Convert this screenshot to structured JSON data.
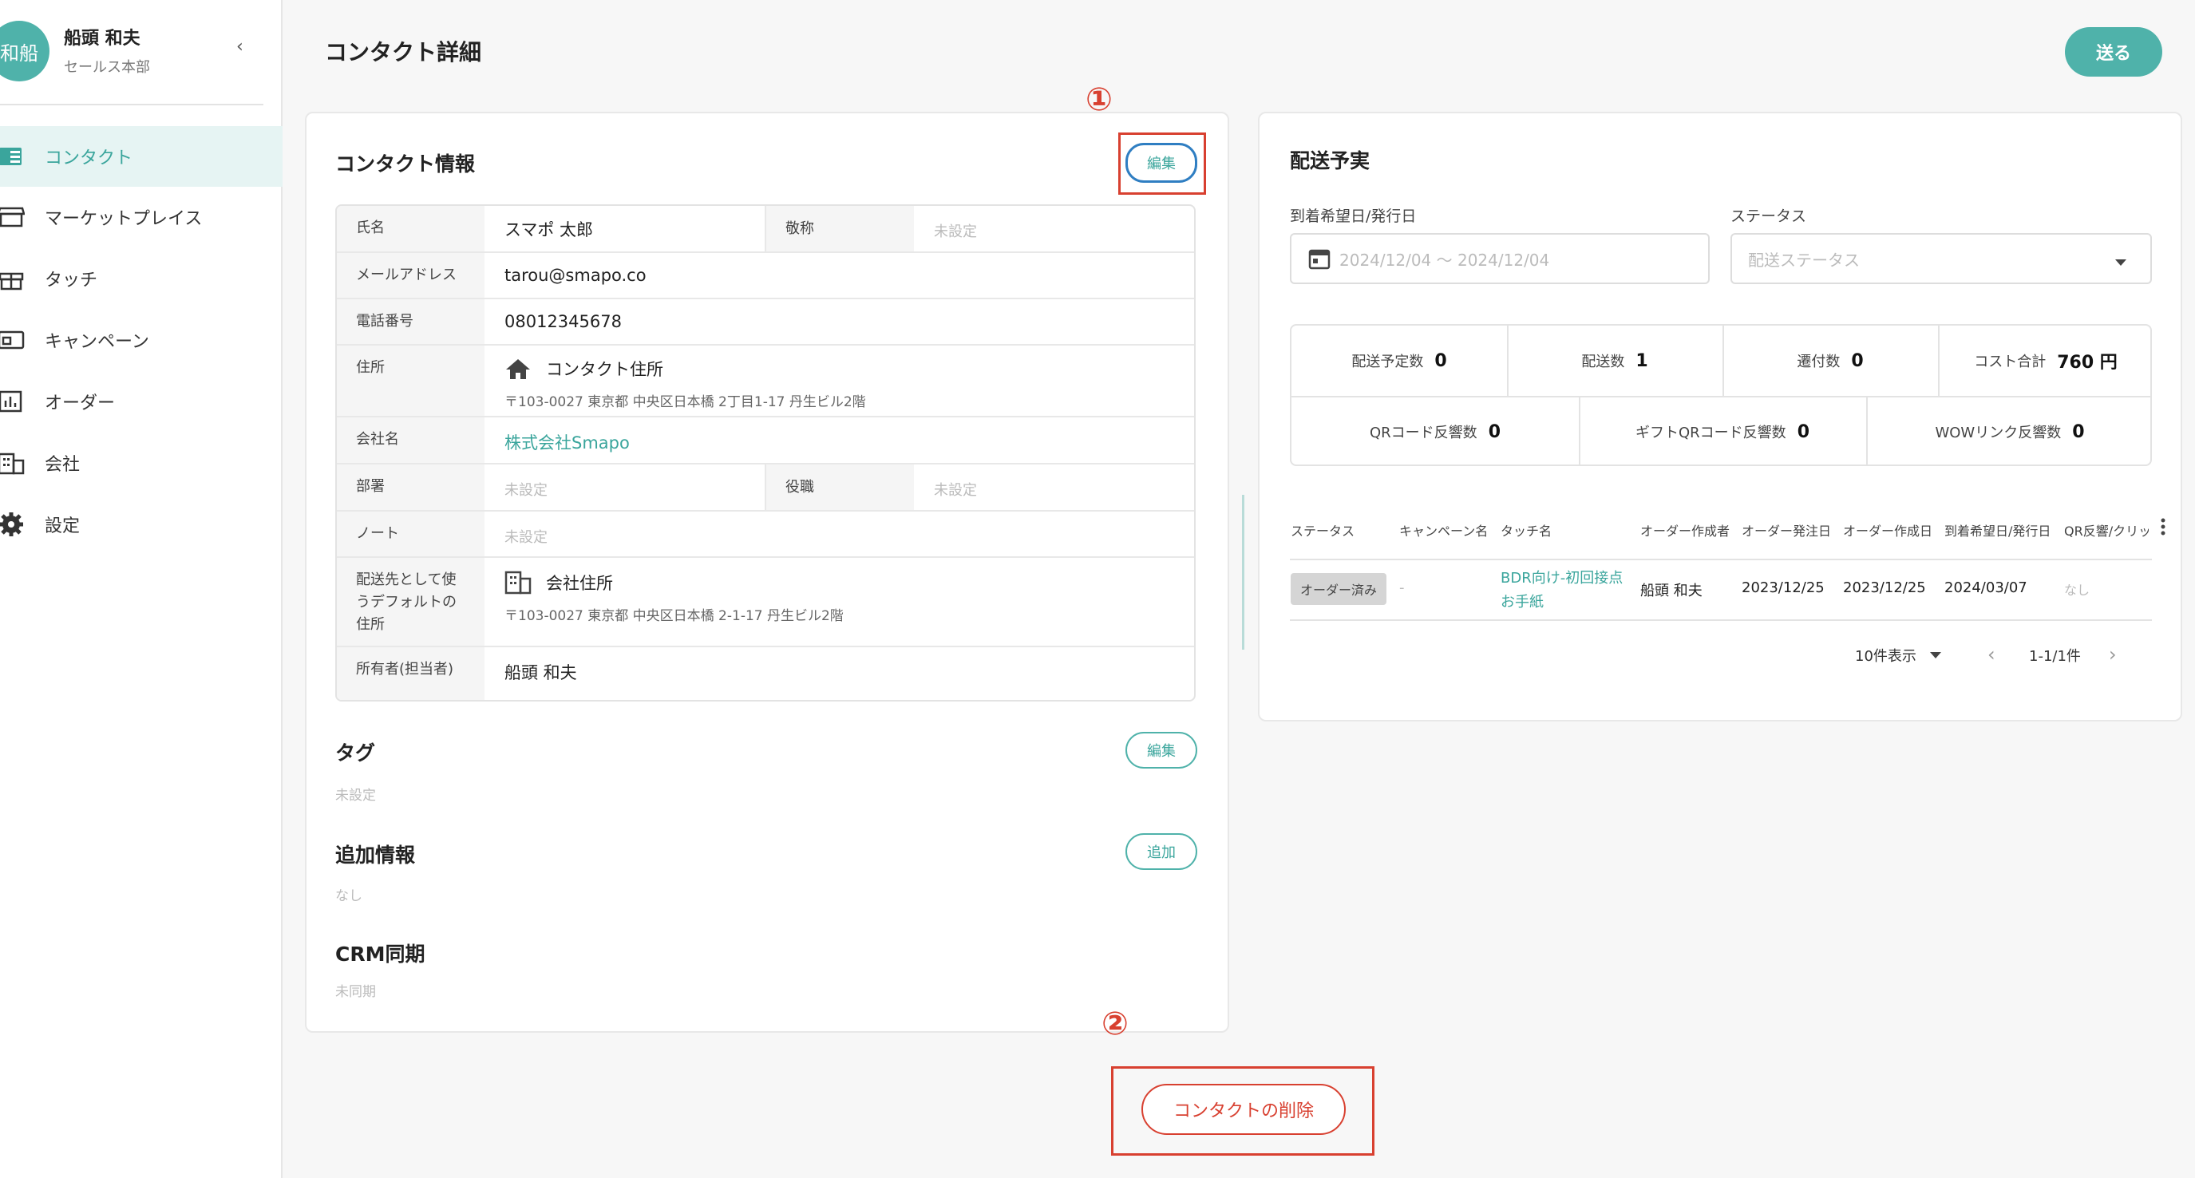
{
  "sidebar": {
    "avatar_text": "和船",
    "user_name": "船頭 和夫",
    "user_dept": "セールス本部",
    "collapse_icon": "‹",
    "items": [
      {
        "label": "コンタクト",
        "icon": "contact-book-icon"
      },
      {
        "label": "マーケットプレイス",
        "icon": "store-icon"
      },
      {
        "label": "タッチ",
        "icon": "gift-icon"
      },
      {
        "label": "キャンペーン",
        "icon": "campaign-icon"
      },
      {
        "label": "オーダー",
        "icon": "chart-icon"
      },
      {
        "label": "会社",
        "icon": "building-icon"
      },
      {
        "label": "設定",
        "icon": "gear-icon"
      }
    ]
  },
  "header": {
    "title": "コンタクト詳細",
    "send_label": "送る"
  },
  "contact": {
    "section_title": "コンタクト情報",
    "edit_label": "編集",
    "rows": {
      "name_label": "氏名",
      "name_value": "スマポ 太郎",
      "honorific_label": "敬称",
      "honorific_value": "未設定",
      "email_label": "メールアドレス",
      "email_value": "tarou@smapo.co",
      "phone_label": "電話番号",
      "phone_value": "08012345678",
      "address_label": "住所",
      "address_title": "コンタクト住所",
      "address_value": "〒103-0027 東京都 中央区日本橋 2丁目1-17 丹生ビル2階",
      "company_label": "会社名",
      "company_value": "株式会社Smapo",
      "department_label": "部署",
      "department_value": "未設定",
      "position_label": "役職",
      "position_value": "未設定",
      "note_label": "ノート",
      "note_value": "未設定",
      "default_addr_label": "配送先として使うデフォルトの住所",
      "default_addr_title": "会社住所",
      "default_addr_value": "〒103-0027 東京都 中央区日本橋 2-1-17 丹生ビル2階",
      "owner_label": "所有者(担当者)",
      "owner_value": "船頭 和夫"
    }
  },
  "tags": {
    "title": "タグ",
    "edit_label": "編集",
    "value": "未設定"
  },
  "extra": {
    "title": "追加情報",
    "add_label": "追加",
    "value": "なし"
  },
  "crm": {
    "title": "CRM同期",
    "value": "未同期"
  },
  "delete_label": "コンタクトの削除",
  "annotations": {
    "one": "①",
    "two": "②"
  },
  "delivery": {
    "title": "配送予実",
    "date_label": "到着希望日/発行日",
    "date_value": "2024/12/04 〜 2024/12/04",
    "status_label": "ステータス",
    "status_placeholder": "配送ステータス",
    "stats": [
      {
        "label": "配送予定数",
        "value": "0"
      },
      {
        "label": "配送数",
        "value": "1"
      },
      {
        "label": "遷付数",
        "value": "0"
      },
      {
        "label": "コスト合計",
        "value": "760 円"
      },
      {
        "label": "QRコード反響数",
        "value": "0"
      },
      {
        "label": "ギフトQRコード反響数",
        "value": "0"
      },
      {
        "label": "WOWリンク反響数",
        "value": "0"
      }
    ],
    "columns": [
      "ステータス",
      "キャンペーン名",
      "タッチ名",
      "オーダー作成者",
      "オーダー発注日",
      "オーダー作成日",
      "到着希望日/発行日",
      "QR反響/クリッ"
    ],
    "row": {
      "status": "オーダー済み",
      "campaign": "-",
      "touch_line1": "BDR向け-初回接点",
      "touch_line2": "お手紙",
      "creator": "船頭 和夫",
      "ordered": "2023/12/25",
      "created": "2023/12/25",
      "arrival": "2024/03/07",
      "qr": "なし"
    },
    "per_page": "10件表示",
    "pagination": "1-1/1件"
  }
}
